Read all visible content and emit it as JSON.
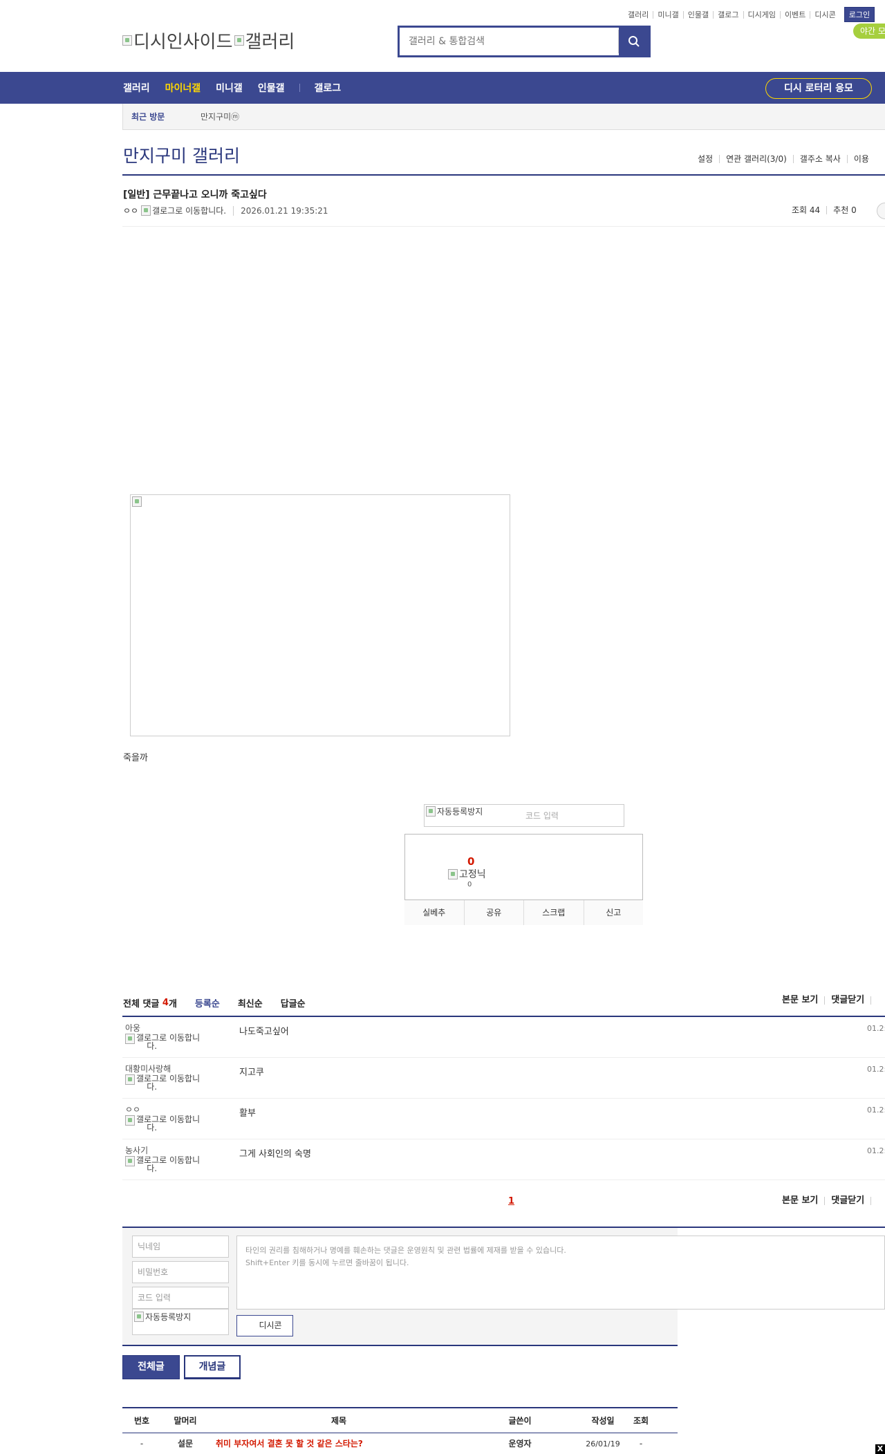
{
  "top_links": [
    "갤러리",
    "미니갤",
    "인물갤",
    "갤로그",
    "디시게임",
    "이벤트",
    "디시콘"
  ],
  "login_label": "로그인",
  "night_mode_label": "야간 모",
  "logo": {
    "alt_1": "디시인사이드",
    "alt_2": "갤러리"
  },
  "search": {
    "placeholder": "갤러리 & 통합검색"
  },
  "nav": {
    "items": [
      "갤러리",
      "마이너갤",
      "미니갤",
      "인물갤"
    ],
    "active": "마이너갤",
    "extra": "갤로그",
    "lottery": "디시 로터리 응모"
  },
  "recent": {
    "label": "최근 방문",
    "item": "만지구미ⓜ"
  },
  "gallery": {
    "title": "만지구미 갤러리",
    "menu": [
      "설정",
      "연관 갤러리(3/0)",
      "갤주소 복사",
      "이용"
    ]
  },
  "post": {
    "title": "[일반] 근무끝나고 오니까 죽고싶다",
    "author": "ㅇㅇ",
    "author_icon_alt": "갤로그로 이동합니다.",
    "date": "2026.01.21 19:35:21",
    "views": "조회 44",
    "recommends": "추천 0",
    "body": "죽을까",
    "image_alt": ""
  },
  "recommend": {
    "captcha_alt": "자동등록방지",
    "captcha_placeholder": "코드 입력",
    "count": "0",
    "nick_alt": "고정닉",
    "sub_count": "0",
    "buttons": [
      "실베추",
      "공유",
      "스크랩",
      "신고"
    ]
  },
  "comments": {
    "total_label": "전체 댓글",
    "count": "4",
    "unit": "개",
    "sorts": [
      "등록순",
      "최신순",
      "답글순"
    ],
    "tools": [
      "본문 보기",
      "댓글닫기"
    ],
    "icon_alt_1": "갤로그로 이동합니",
    "icon_alt_2": "다.",
    "items": [
      {
        "nick": "아웅",
        "text": "나도죽고싶어",
        "date": "01.2:"
      },
      {
        "nick": "대황미사랑해",
        "text": "지고쿠",
        "date": "01.2:"
      },
      {
        "nick": "ㅇㅇ",
        "text": "활부",
        "date": "01.2:"
      },
      {
        "nick": "농사기",
        "text": "그게 사회인의 숙명",
        "date": "01.2:"
      }
    ],
    "page": "1"
  },
  "write": {
    "nick_placeholder": "닉네임",
    "pw_placeholder": "비밀번호",
    "code_placeholder": "코드 입력",
    "captcha_alt": "자동등록방지",
    "textarea_line1": "타인의 권리를 침해하거나 명예를 훼손하는 댓글은 운영원칙 및 관련 법률에 제재를 받을 수 있습니다.",
    "textarea_line2": "Shift+Enter 키를 동시에 누르면 줄바꿈이 됩니다.",
    "dccon": "디시콘"
  },
  "tabs": {
    "all": "전체글",
    "best": "개념글"
  },
  "list": {
    "headers": [
      "번호",
      "말머리",
      "제목",
      "글쓴이",
      "작성일",
      "조회"
    ],
    "row": {
      "num": "-",
      "head": "설문",
      "title": "취미 부자여서 결혼 못 할 것 같은 스타는?",
      "writer": "운영자",
      "date": "26/01/19",
      "views": "-"
    }
  },
  "close_label": "X"
}
